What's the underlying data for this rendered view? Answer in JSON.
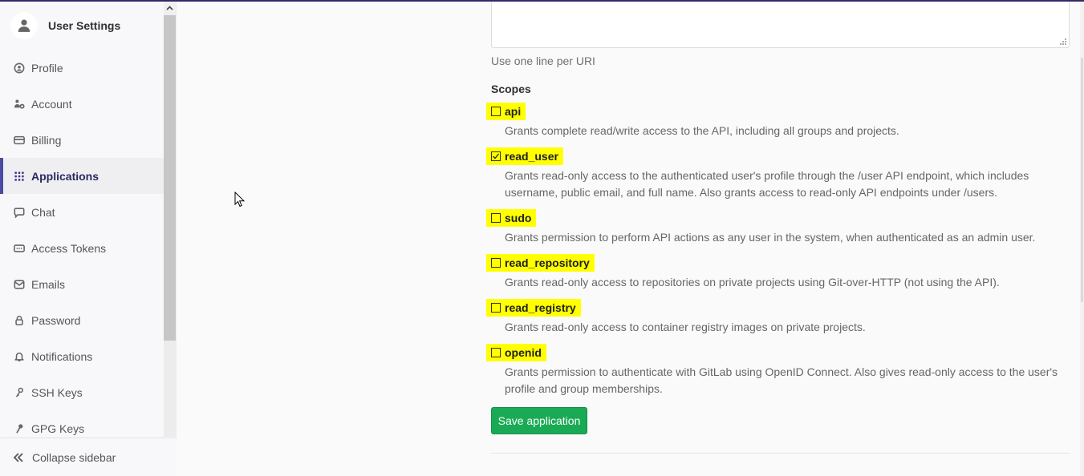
{
  "sidebar": {
    "title": "User Settings",
    "items": [
      {
        "label": "Profile",
        "icon": "profile-icon",
        "active": false
      },
      {
        "label": "Account",
        "icon": "account-icon",
        "active": false
      },
      {
        "label": "Billing",
        "icon": "billing-icon",
        "active": false
      },
      {
        "label": "Applications",
        "icon": "applications-icon",
        "active": true
      },
      {
        "label": "Chat",
        "icon": "chat-icon",
        "active": false
      },
      {
        "label": "Access Tokens",
        "icon": "access-tokens-icon",
        "active": false
      },
      {
        "label": "Emails",
        "icon": "emails-icon",
        "active": false
      },
      {
        "label": "Password",
        "icon": "lock-icon",
        "active": false
      },
      {
        "label": "Notifications",
        "icon": "bell-icon",
        "active": false
      },
      {
        "label": "SSH Keys",
        "icon": "key-icon",
        "active": false
      },
      {
        "label": "GPG Keys",
        "icon": "key-icon",
        "active": false
      }
    ],
    "collapse_label": "Collapse sidebar"
  },
  "form": {
    "redirect_uri_value": "",
    "redirect_uri_help": "Use one line per URI",
    "scopes_label": "Scopes",
    "scopes": [
      {
        "name": "api",
        "checked": false,
        "description": "Grants complete read/write access to the API, including all groups and projects."
      },
      {
        "name": "read_user",
        "checked": true,
        "description": "Grants read-only access to the authenticated user's profile through the /user API endpoint, which includes username, public email, and full name. Also grants access to read-only API endpoints under /users."
      },
      {
        "name": "sudo",
        "checked": false,
        "description": "Grants permission to perform API actions as any user in the system, when authenticated as an admin user."
      },
      {
        "name": "read_repository",
        "checked": false,
        "description": "Grants read-only access to repositories on private projects using Git-over-HTTP (not using the API)."
      },
      {
        "name": "read_registry",
        "checked": false,
        "description": "Grants read-only access to container registry images on private projects."
      },
      {
        "name": "openid",
        "checked": false,
        "description": "Grants permission to authenticate with GitLab using OpenID Connect. Also gives read-only access to the user's profile and group memberships."
      }
    ],
    "save_label": "Save application"
  },
  "colors": {
    "accent": "#4b4ba3",
    "highlight": "#ffff00",
    "save_button": "#1aaa55",
    "top_border": "#2f2a6b"
  }
}
